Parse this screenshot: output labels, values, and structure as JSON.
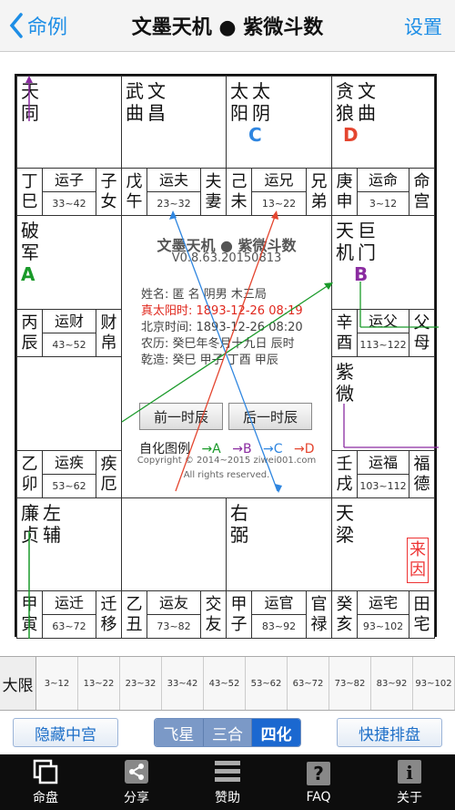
{
  "header": {
    "back_label": "命例",
    "title": "文墨天机 ● 紫微斗数",
    "settings_label": "设置"
  },
  "palaces": [
    {
      "id": "si",
      "stars": [
        "天同"
      ],
      "trans": "",
      "stem": [
        "丁",
        "巳"
      ],
      "yun": "运子",
      "age": "33~42",
      "palace": [
        "子",
        "女"
      ]
    },
    {
      "id": "wu",
      "stars": [
        "武曲",
        "文昌"
      ],
      "trans": "",
      "stem": [
        "戊",
        "午"
      ],
      "yun": "运夫",
      "age": "23~32",
      "palace": [
        "夫",
        "妻"
      ]
    },
    {
      "id": "wei",
      "stars": [
        "太阳",
        "太阴"
      ],
      "trans": "C",
      "trans_color": "#2f86e0",
      "stem": [
        "己",
        "未"
      ],
      "yun": "运兄",
      "age": "13~22",
      "palace": [
        "兄",
        "弟"
      ]
    },
    {
      "id": "shen",
      "stars": [
        "贪狼",
        "文曲"
      ],
      "trans": "D",
      "trans_color": "#e4452f",
      "stem": [
        "庚",
        "申"
      ],
      "yun": "运命",
      "age": "3~12",
      "palace": [
        "命",
        "宫"
      ]
    },
    {
      "id": "chen",
      "stars": [
        "破军"
      ],
      "trans": "A",
      "trans_color": "#1a9a2a",
      "stem": [
        "丙",
        "辰"
      ],
      "yun": "运财",
      "age": "43~52",
      "palace": [
        "财",
        "帛"
      ]
    },
    {
      "id": "you",
      "stars": [
        "天机",
        "巨门"
      ],
      "trans": "B",
      "trans_color": "#8a2ba0",
      "stem": [
        "辛",
        "酉"
      ],
      "yun": "运父",
      "age": "113~122",
      "palace": [
        "父",
        "母"
      ]
    },
    {
      "id": "mao",
      "stars": [],
      "trans": "",
      "stem": [
        "乙",
        "卯"
      ],
      "yun": "运疾",
      "age": "53~62",
      "palace": [
        "疾",
        "厄"
      ]
    },
    {
      "id": "xu",
      "stars": [
        "紫微"
      ],
      "trans": "",
      "stem": [
        "壬",
        "戌"
      ],
      "yun": "运福",
      "age": "103~112",
      "palace": [
        "福",
        "德"
      ]
    },
    {
      "id": "yin",
      "stars": [
        "廉贞",
        "左辅"
      ],
      "trans": "",
      "stem": [
        "甲",
        "寅"
      ],
      "yun": "运迁",
      "age": "63~72",
      "palace": [
        "迁",
        "移"
      ]
    },
    {
      "id": "chou",
      "stars": [],
      "trans": "",
      "stem": [
        "乙",
        "丑"
      ],
      "yun": "运友",
      "age": "73~82",
      "palace": [
        "交",
        "友"
      ]
    },
    {
      "id": "zi",
      "stars": [
        "右弼"
      ],
      "trans": "",
      "stem": [
        "甲",
        "子"
      ],
      "yun": "运官",
      "age": "83~92",
      "palace": [
        "官",
        "禄"
      ]
    },
    {
      "id": "hai",
      "stars": [
        "天梁"
      ],
      "trans": "",
      "stem": [
        "癸",
        "亥"
      ],
      "yun": "运宅",
      "age": "93~102",
      "palace": [
        "田",
        "宅"
      ],
      "laiyin": "来因"
    }
  ],
  "center": {
    "title": "文墨天机 ● 紫微斗数",
    "version": "V0.8.63.20150813",
    "name_line": "姓名: 匿 名      阴男 木三局",
    "solar_true": "真太阳时: 1893-12-26  08:19",
    "beijing": "北京时间: 1893-12-26  08:20",
    "lunar": "农历: 癸巳年冬月十九日 辰时",
    "ganzhi": "乾造: 癸巳  甲子  丁酉  甲辰",
    "prev_btn": "前一时辰",
    "next_btn": "后一时辰",
    "sihua_label": "自化图例",
    "sihua_items": [
      "→A",
      "→B",
      "→C",
      "→D"
    ],
    "sihua_colors": [
      "#1a9a2a",
      "#8a2ba0",
      "#2f86e0",
      "#e4452f"
    ],
    "copyright": "Copyright © 2014~2015 ziwei001.com",
    "rights": "All rights reserved."
  },
  "daxian": {
    "label": "大限",
    "items": [
      "3~12",
      "13~22",
      "23~32",
      "33~42",
      "43~52",
      "53~62",
      "63~72",
      "73~82",
      "83~92",
      "93~102"
    ]
  },
  "actions": {
    "hide_center": "隐藏中宫",
    "tabs": [
      "飞星",
      "三合",
      "四化"
    ],
    "quick": "快捷排盘"
  },
  "nav": [
    {
      "label": "命盘",
      "icon": "copy-icon"
    },
    {
      "label": "分享",
      "icon": "share-icon"
    },
    {
      "label": "赞助",
      "icon": "menu-icon"
    },
    {
      "label": "FAQ",
      "icon": "question-icon"
    },
    {
      "label": "关于",
      "icon": "info-icon"
    }
  ]
}
